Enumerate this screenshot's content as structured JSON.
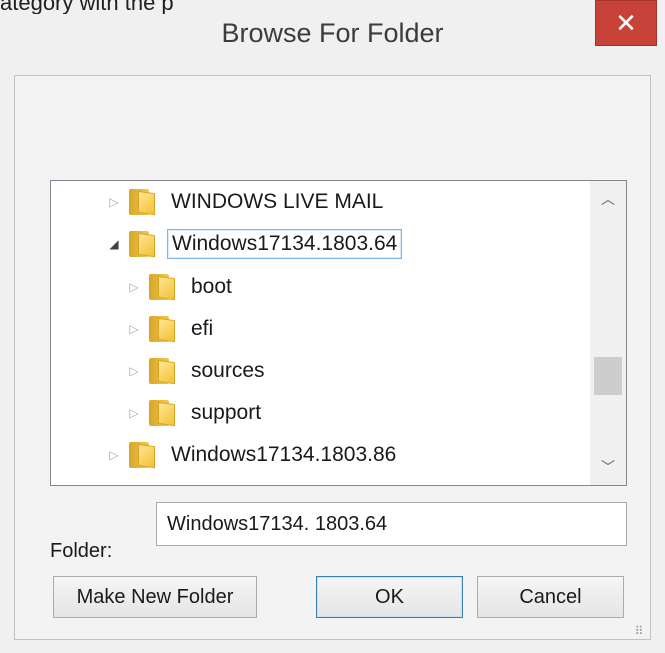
{
  "window": {
    "title": "Browse For Folder",
    "title_fragment": "ategory with the p",
    "close_symbol": "✕"
  },
  "tree": {
    "items": [
      {
        "label": "WINDOWS LIVE MAIL",
        "expanded": false,
        "selected": false
      },
      {
        "label": "Windows17134.1803.64",
        "expanded": true,
        "selected": true
      },
      {
        "label": "boot",
        "expanded": false,
        "selected": false
      },
      {
        "label": "efi",
        "expanded": false,
        "selected": false
      },
      {
        "label": "sources",
        "expanded": false,
        "selected": false
      },
      {
        "label": "support",
        "expanded": false,
        "selected": false
      },
      {
        "label": "Windows17134.1803.86",
        "expanded": false,
        "selected": false
      }
    ],
    "collapsed_arrow": "▷",
    "expanded_arrow": "◢"
  },
  "scrollbar": {
    "up_arrow": "︿",
    "down_arrow": "﹀"
  },
  "folder_field": {
    "label": "Folder:",
    "value": "Windows17134. 1803.64"
  },
  "buttons": {
    "make_new_folder": "Make New Folder",
    "ok": "OK",
    "cancel": "Cancel"
  },
  "grip_symbol": "⠿",
  "colors": {
    "close_button": "#c7433a",
    "selection_border": "#7eb4ea",
    "folder_yellow": "#f1c232"
  }
}
